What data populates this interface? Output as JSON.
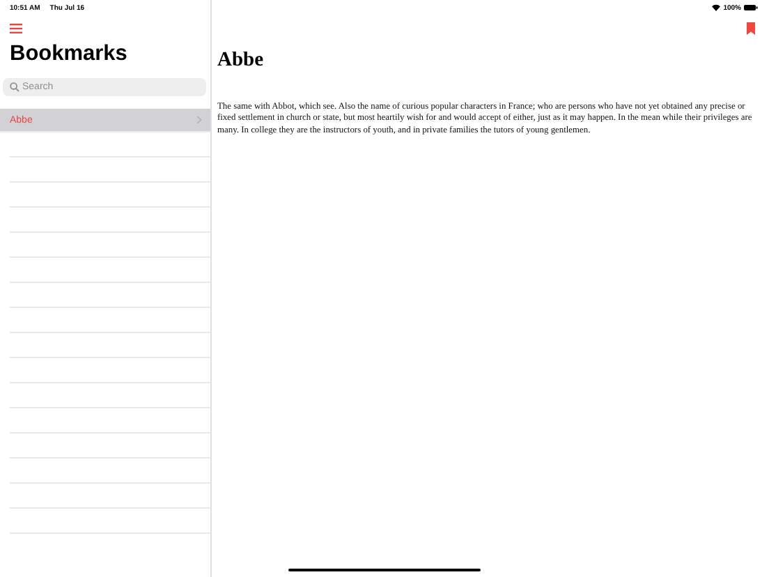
{
  "status_bar": {
    "time": "10:51 AM",
    "date": "Thu Jul 16",
    "battery": "100%"
  },
  "sidebar": {
    "title": "Bookmarks",
    "search": {
      "placeholder": "Search"
    },
    "items": [
      {
        "label": "Abbe",
        "selected": true
      }
    ]
  },
  "entry": {
    "title": "Abbe",
    "body": "The same with Abbot, which see. Also the name of curious popular characters in France; who are persons who have not yet obtained any precise or fixed settlement in church or state, but most heartily wish for and would accept of either, just as it may happen. In the mean while their privileges are many. In college they are the instructors of youth, and in private families the tutors of young gentlemen."
  }
}
